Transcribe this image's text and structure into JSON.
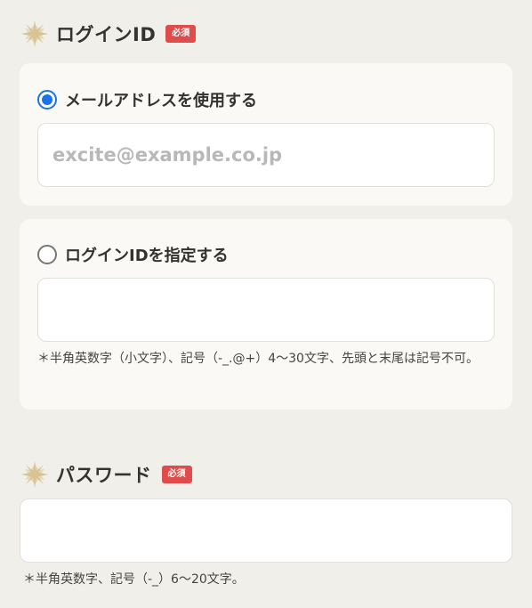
{
  "login_id": {
    "title": "ログインID",
    "badge": "必須",
    "email_option": {
      "label": "メールアドレスを使用する",
      "selected": true,
      "placeholder": "excite@example.co.jp",
      "value": ""
    },
    "custom_option": {
      "label": "ログインIDを指定する",
      "selected": false,
      "placeholder": "",
      "value": "",
      "note": "＊半角英数字（小文字）、記号（-_.@+）4〜30文字、先頭と末尾は記号不可。"
    }
  },
  "password": {
    "title": "パスワード",
    "badge": "必須",
    "placeholder": "",
    "value": "",
    "note": "＊半角英数字、記号（-_）6〜20文字。"
  },
  "colors": {
    "background": "#f0efea",
    "card": "#faf9f6",
    "badge": "#e04b4b",
    "radio_selected": "#1a73e8",
    "burst_icon": "#d8c493"
  },
  "icons": {
    "section_marker": "sparkle-burst-icon"
  }
}
